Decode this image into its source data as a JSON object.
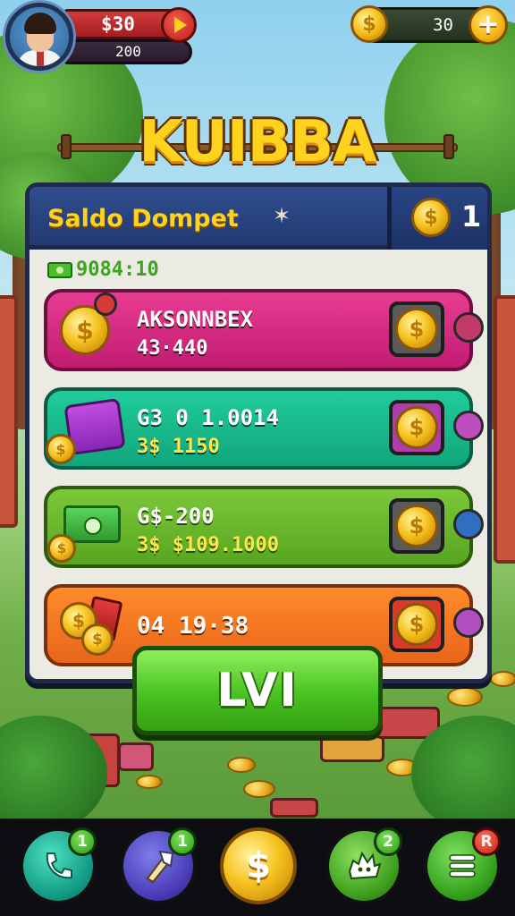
{
  "hud": {
    "balance_top": "$30",
    "balance_bottom": "200",
    "coins": "30",
    "plus_label": "+"
  },
  "title": "KUIBBA",
  "panel": {
    "title": "Saldo Dompet",
    "star": "✶",
    "header_count": "1",
    "cash_label": "9084:10",
    "rows": [
      {
        "line1": "AKSONNBEX",
        "line2": "43·440",
        "color": "#d8287f",
        "badge_color": "#c23a6a"
      },
      {
        "line1": "G3 0 1.0014",
        "line2": "3$ 1150",
        "color": "#17b98b",
        "badge_color": "#c04dc0"
      },
      {
        "line1": "G$-200",
        "line2": "3$ $109.1000",
        "color": "#6ab92c",
        "badge_color": "#2f6fc0"
      },
      {
        "line1": "04 19·38",
        "line2": "",
        "color": "#f47a22",
        "badge_color": "#b04ec0"
      }
    ]
  },
  "action_button": "LVI",
  "nav": [
    {
      "icon": "phone-icon",
      "badge": "1"
    },
    {
      "icon": "hammer-icon",
      "badge": "1"
    },
    {
      "icon": "coin-icon",
      "badge": ""
    },
    {
      "icon": "monster-icon",
      "badge": "2"
    },
    {
      "icon": "menu-icon",
      "badge": "R"
    }
  ],
  "coin_symbol": "$"
}
